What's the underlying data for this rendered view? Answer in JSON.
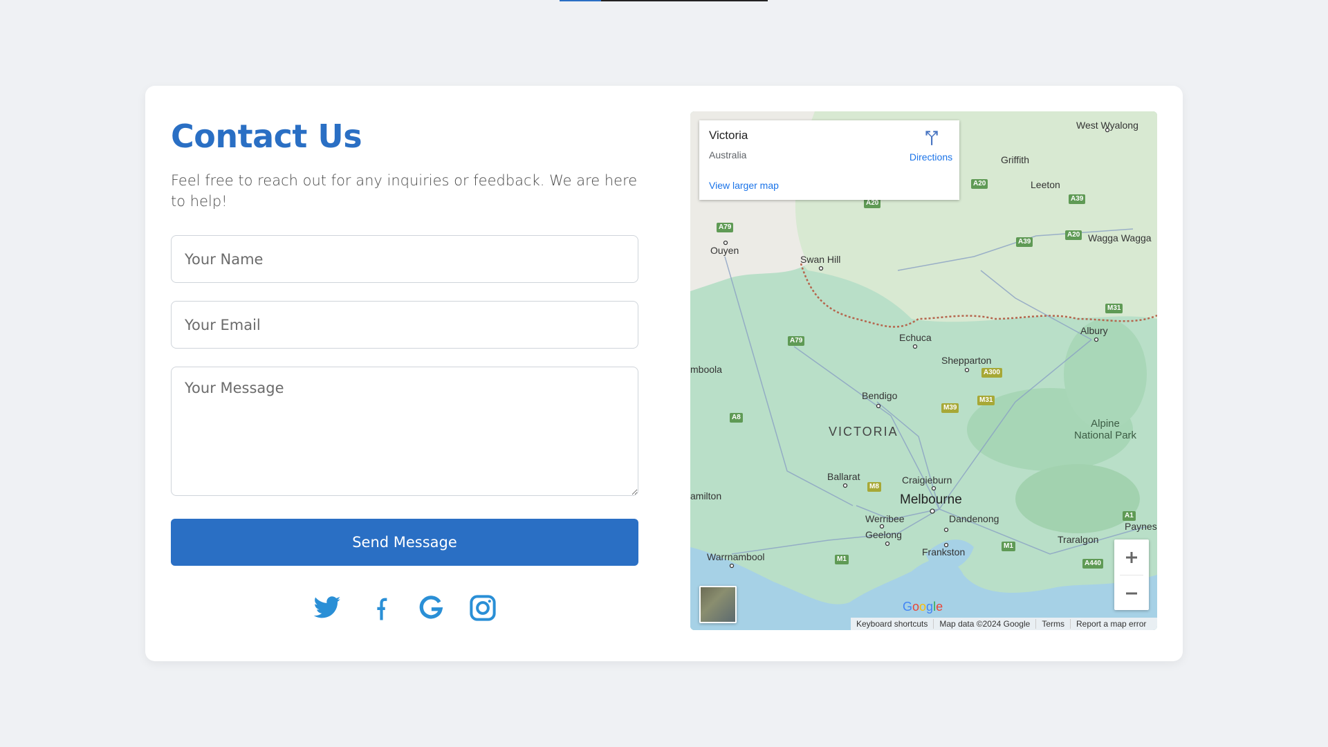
{
  "contact": {
    "title": "Contact Us",
    "subtitle": "Feel free to reach out for any inquiries or feedback. We are here to help!",
    "name_placeholder": "Your Name",
    "email_placeholder": "Your Email",
    "message_placeholder": "Your Message",
    "send_label": "Send Message",
    "socials": [
      "twitter-icon",
      "facebook-icon",
      "google-icon",
      "instagram-icon"
    ],
    "accent_color": "#2a6fc4"
  },
  "map": {
    "place_name": "Victoria",
    "place_region": "Australia",
    "directions_label": "Directions",
    "larger_map_label": "View larger map",
    "region_label": "VICTORIA",
    "cities": {
      "west_wyalong": "West Wyalong",
      "griffith": "Griffith",
      "leeton": "Leeton",
      "wagga": "Wagga Wagga",
      "ouyen": "Ouyen",
      "swan_hill": "Swan Hill",
      "albury": "Albury",
      "echuca": "Echuca",
      "shepparton": "Shepparton",
      "horsham": "mboola",
      "bendigo": "Bendigo",
      "alpine": "Alpine\nNational Park",
      "ballarat": "Ballarat",
      "craigieburn": "Craigieburn",
      "hamilton": "amilton",
      "melbourne": "Melbourne",
      "werribee": "Werribee",
      "dandenong": "Dandenong",
      "geelong": "Geelong",
      "traralgon": "Traralgon",
      "paynes": "Paynes",
      "warrnambool": "Warrnambool",
      "frankston": "Frankston"
    },
    "roads": {
      "a20a": "A20",
      "a20b": "A20",
      "a20c": "A20",
      "a39a": "A39",
      "a39b": "A39",
      "a79a": "A79",
      "a79b": "A79",
      "m31a": "M31",
      "m31b": "M31",
      "a300": "A300",
      "m39": "M39",
      "a8": "A8",
      "m8": "M8",
      "m1a": "M1",
      "m1b": "M1",
      "a1": "A1",
      "a440": "A440"
    },
    "google_logo": "Google",
    "attribution": {
      "keyboard": "Keyboard shortcuts",
      "data": "Map data ©2024 Google",
      "terms": "Terms",
      "report": "Report a map error"
    }
  }
}
